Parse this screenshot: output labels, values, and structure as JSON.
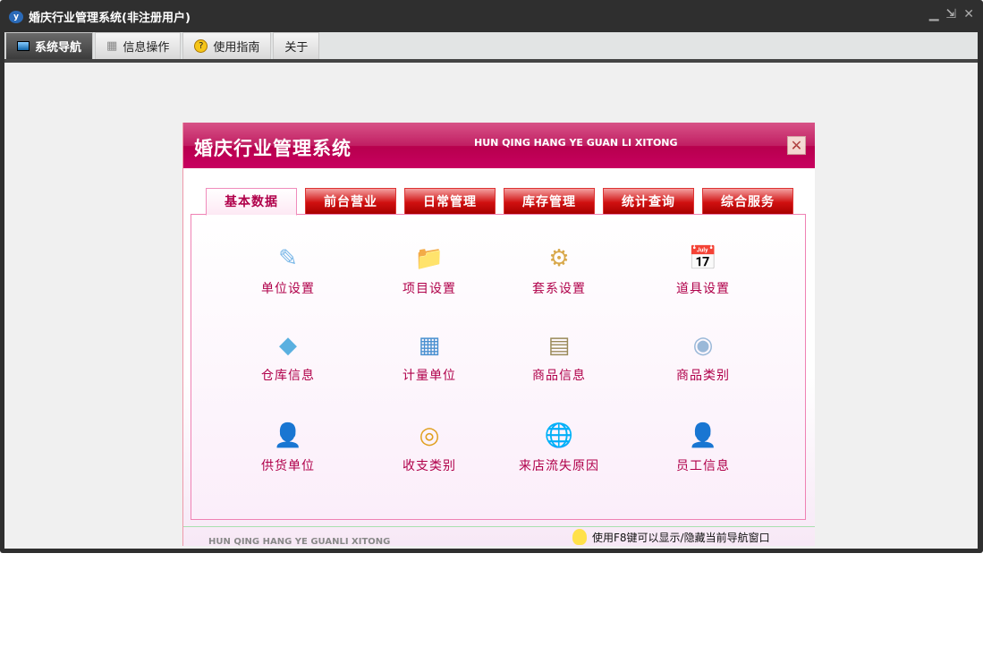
{
  "window": {
    "title": "婚庆行业管理系统(非注册用户)",
    "controls": [
      "minimize",
      "restore",
      "close"
    ]
  },
  "tabs": [
    {
      "label": "系统导航",
      "icon": "monitor-icon"
    },
    {
      "label": "信息操作",
      "icon": "grid-icon"
    },
    {
      "label": "使用指南",
      "icon": "help-icon"
    },
    {
      "label": "关于"
    }
  ],
  "panel": {
    "title": "婚庆行业管理系统",
    "subtitle": "HUN QING HANG YE GUAN LI XITONG",
    "tabs": [
      "基本数据",
      "前台营业",
      "日常管理",
      "库存管理",
      "统计查询",
      "综合服务"
    ],
    "items": [
      {
        "label": "单位设置",
        "icon": "✎"
      },
      {
        "label": "项目设置",
        "icon": "📁"
      },
      {
        "label": "套系设置",
        "icon": "⚙"
      },
      {
        "label": "道具设置",
        "icon": "📅"
      },
      {
        "label": "仓库信息",
        "icon": "◆"
      },
      {
        "label": "计量单位",
        "icon": "▦"
      },
      {
        "label": "商品信息",
        "icon": "▤"
      },
      {
        "label": "商品类别",
        "icon": "◉"
      },
      {
        "label": "供货单位",
        "icon": "👤"
      },
      {
        "label": "收支类别",
        "icon": "◎"
      },
      {
        "label": "来店流失原因",
        "icon": "🌐"
      },
      {
        "label": "员工信息",
        "icon": "👤"
      }
    ],
    "footer_left": "HUN QING HANG YE GUANLI XITONG",
    "footer_hint": "使用F8键可以显示/隐藏当前导航窗口"
  }
}
